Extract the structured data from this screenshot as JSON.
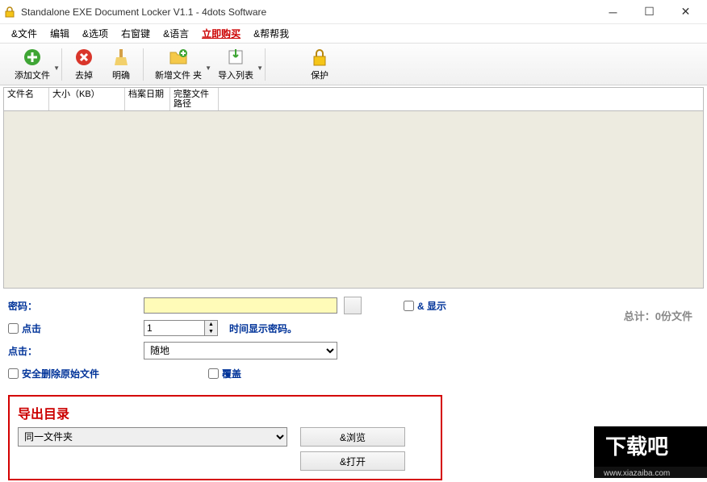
{
  "window": {
    "title": "Standalone EXE Document Locker V1.1 - 4dots Software"
  },
  "menu": {
    "file": "&文件",
    "edit": "编辑",
    "options": "&选项",
    "rightkey": "右窗键",
    "lang": "&语言",
    "buy": "立即购买",
    "help": "&帮帮我"
  },
  "toolbar": {
    "add": "添加文件",
    "remove": "去掉",
    "clear": "明确",
    "newFolder": "新增文件 夹",
    "importList": "导入列表",
    "protect": "保护"
  },
  "columns": {
    "name": "文件名",
    "size": "大小（KB）",
    "date": "档案日期",
    "path": "完整文件路径"
  },
  "form": {
    "passwordLabel": "密码：",
    "clickLabel": "点击",
    "spinValue": "1",
    "timeShow": "时间显示密码。",
    "showLabel": "& 显示",
    "clickLabel2": "点击：",
    "randomOption": "随地",
    "secureDelete": "安全删除原始文件",
    "overwrite": "覆盖",
    "totalLabel": "总计：0份文件"
  },
  "export": {
    "title": "导出目录",
    "sameFolder": "同一文件夹",
    "browse": "&浏览",
    "open": "&打开"
  },
  "watermark": {
    "text1": "下载吧",
    "text2": "www.xiazaiba.com"
  }
}
